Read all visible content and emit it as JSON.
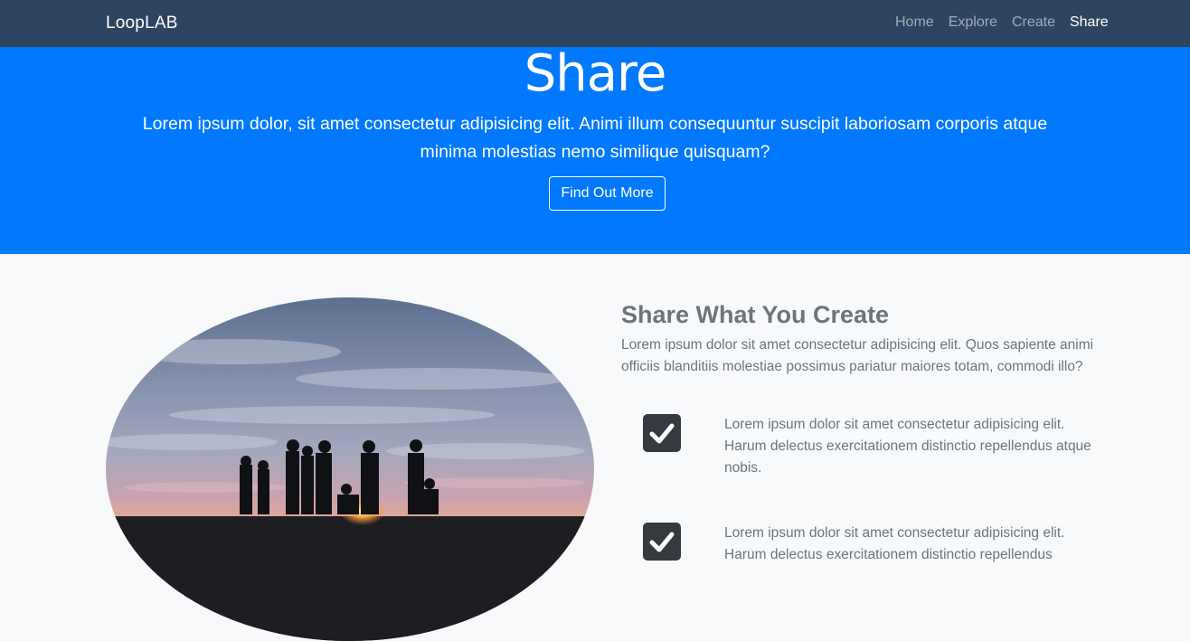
{
  "navbar": {
    "brand": "LoopLAB",
    "links": [
      {
        "label": "Home",
        "active": false
      },
      {
        "label": "Explore",
        "active": false
      },
      {
        "label": "Create",
        "active": false
      },
      {
        "label": "Share",
        "active": true
      }
    ]
  },
  "hero": {
    "title": "Share",
    "text": "Lorem ipsum dolor, sit amet consectetur adipisicing elit. Animi illum consequuntur suscipit laboriosam corporis atque minima molestias nemo similique quisquam?",
    "button_label": "Find Out More",
    "background_color": "#0079ff"
  },
  "feature": {
    "title": "Share What You Create",
    "text": "Lorem ipsum dolor sit amet consectetur adipisicing elit. Quos sapiente animi officiis blanditiis molestiae possimus pariatur maiores totam, commodi illo?",
    "items": [
      {
        "icon": "check-square-icon",
        "text": "Lorem ipsum dolor sit amet consectetur adipisicing elit. Harum delectus exercitationem distinctio repellendus atque nobis."
      },
      {
        "icon": "check-square-icon",
        "text": "Lorem ipsum dolor sit amet consectetur adipisicing elit. Harum delectus exercitationem distinctio repellendus"
      }
    ]
  }
}
